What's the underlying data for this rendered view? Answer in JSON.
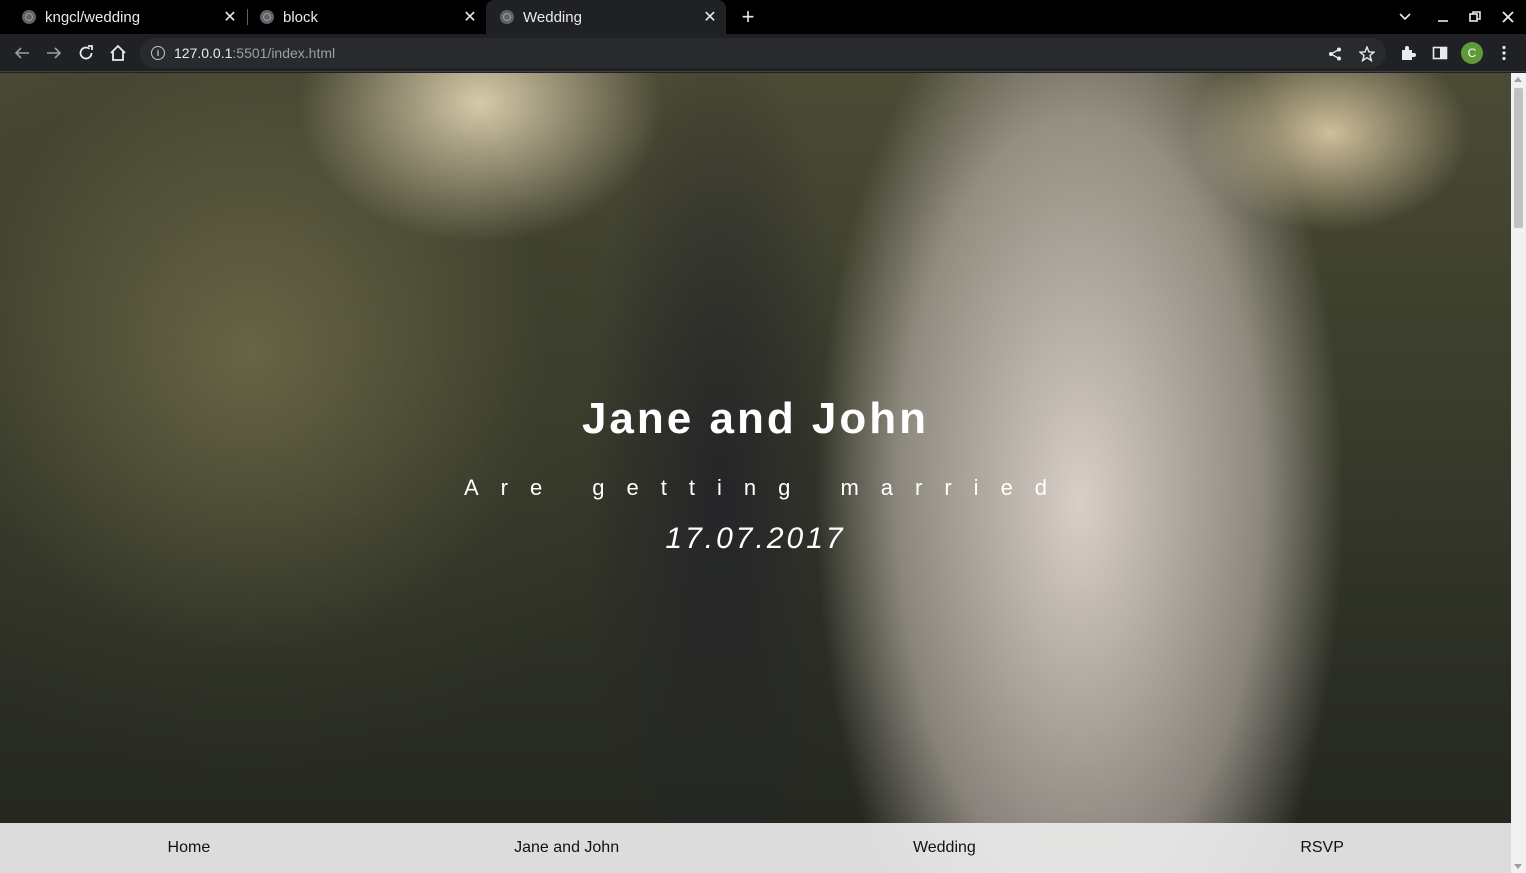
{
  "browser": {
    "tabs": [
      {
        "title": "kngcl/wedding",
        "icon": "github-icon",
        "active": false
      },
      {
        "title": "block",
        "icon": "globe-icon",
        "active": false
      },
      {
        "title": "Wedding",
        "icon": "globe-icon",
        "active": true
      }
    ],
    "url": {
      "host": "127.0.0.1",
      "rest": ":5501/index.html"
    },
    "profile_initial": "C",
    "profile_color": "#5f9a3a"
  },
  "hero": {
    "title": "Jane and John",
    "subtitle": "Are getting married",
    "date": "17.07.2017"
  },
  "nav": {
    "items": [
      "Home",
      "Jane and John",
      "Wedding",
      "RSVP"
    ]
  }
}
